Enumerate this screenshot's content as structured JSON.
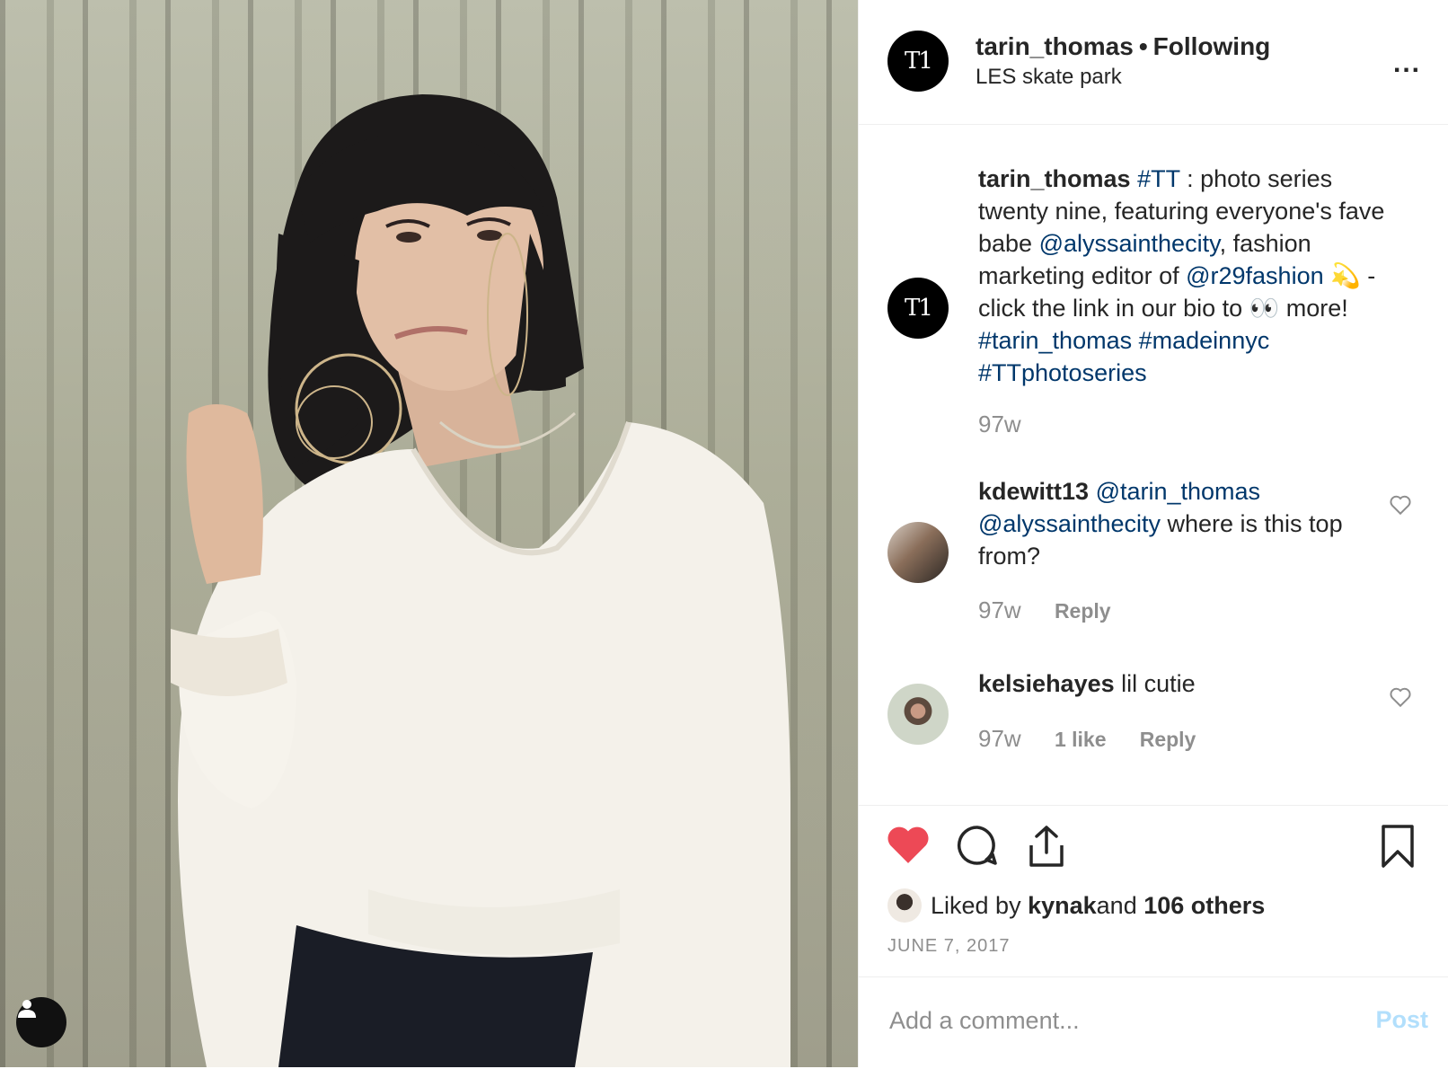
{
  "header": {
    "avatar_text": "T1",
    "username": "tarin_thomas",
    "separator": "•",
    "follow_status": "Following",
    "location": "LES skate park",
    "more_label": "..."
  },
  "caption": {
    "avatar_text": "T1",
    "username": "tarin_thomas",
    "t1": "#TT",
    "t2": " : photo series twenty nine, featuring everyone's fave babe ",
    "t3": "@alyssainthecity",
    "t4": ", fashion marketing editor of ",
    "t5": "@r29fashion",
    "t6": " 💫 - click the link in our bio to 👀  more! ",
    "t7": "#tarin_thomas",
    "t8": " ",
    "t9": "#madeinnyc",
    "t10": " ",
    "t11": "#TTphotoseries",
    "time": "97w"
  },
  "comments": [
    {
      "username": "kdewitt13",
      "m1": "@tarin_thomas",
      "m2": "@alyssainthecity",
      "text": " where is this top from?",
      "time": "97w",
      "reply": "Reply"
    },
    {
      "username": "kelsiehayes",
      "text": " lil cutie",
      "time": "97w",
      "likes": "1 like",
      "reply": "Reply"
    }
  ],
  "likes": {
    "prefix": "Liked by ",
    "user": "kynak",
    "middle": " and ",
    "others": "106 others"
  },
  "date": "JUNE 7, 2017",
  "add_comment": {
    "placeholder": "Add a comment...",
    "post_label": "Post"
  },
  "colors": {
    "like_red": "#ed4956",
    "link_blue": "#00376b",
    "post_disabled": "#b2dffc"
  },
  "icons": [
    "user-tag-icon",
    "more-icon",
    "heart-icon",
    "comment-icon",
    "share-icon",
    "bookmark-icon"
  ]
}
